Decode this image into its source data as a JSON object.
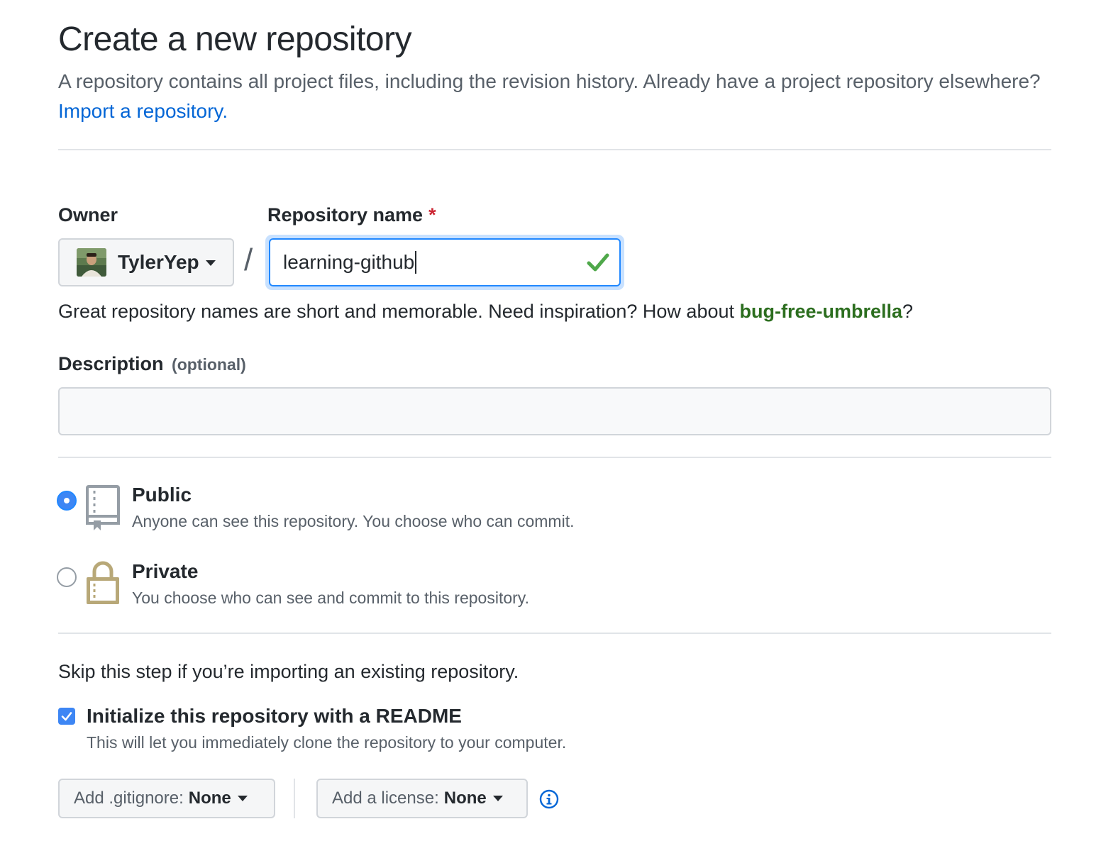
{
  "header": {
    "title": "Create a new repository",
    "subtitle": "A repository contains all project files, including the revision history. Already have a project repository elsewhere?",
    "import_link": "Import a repository."
  },
  "owner": {
    "label": "Owner",
    "value": "TylerYep",
    "icons": {
      "avatar": "avatar-image",
      "caret": "caret-down-icon"
    }
  },
  "separator": "/",
  "repo_name": {
    "label": "Repository name",
    "required_mark": "*",
    "value": "learning-github",
    "valid_icon": "check-icon"
  },
  "hint": {
    "text": "Great repository names are short and memorable. Need inspiration? How about",
    "suggestion": "bug-free-umbrella",
    "trailing": "?"
  },
  "description": {
    "label": "Description",
    "optional": "(optional)",
    "value": ""
  },
  "visibility": {
    "selected": "public",
    "options": [
      {
        "title": "Public",
        "desc": "Anyone can see this repository. You choose who can commit.",
        "icon": "repo-book-icon"
      },
      {
        "title": "Private",
        "desc": "You choose who can see and commit to this repository.",
        "icon": "lock-icon"
      }
    ]
  },
  "init": {
    "skip_text": "Skip this step if you’re importing an existing repository.",
    "readme_label": "Initialize this repository with a README",
    "readme_desc": "This will let you immediately clone the repository to your computer.",
    "readme_checked": true
  },
  "selects": {
    "gitignore_label": "Add .gitignore:",
    "gitignore_value": "None",
    "license_label": "Add a license:",
    "license_value": "None",
    "info_icon": "info-icon"
  },
  "colors": {
    "accent": "#3d86f4",
    "link": "#0366d6",
    "success": "#2c6e1f",
    "lock": "#b8a878",
    "required": "#cb2431"
  }
}
